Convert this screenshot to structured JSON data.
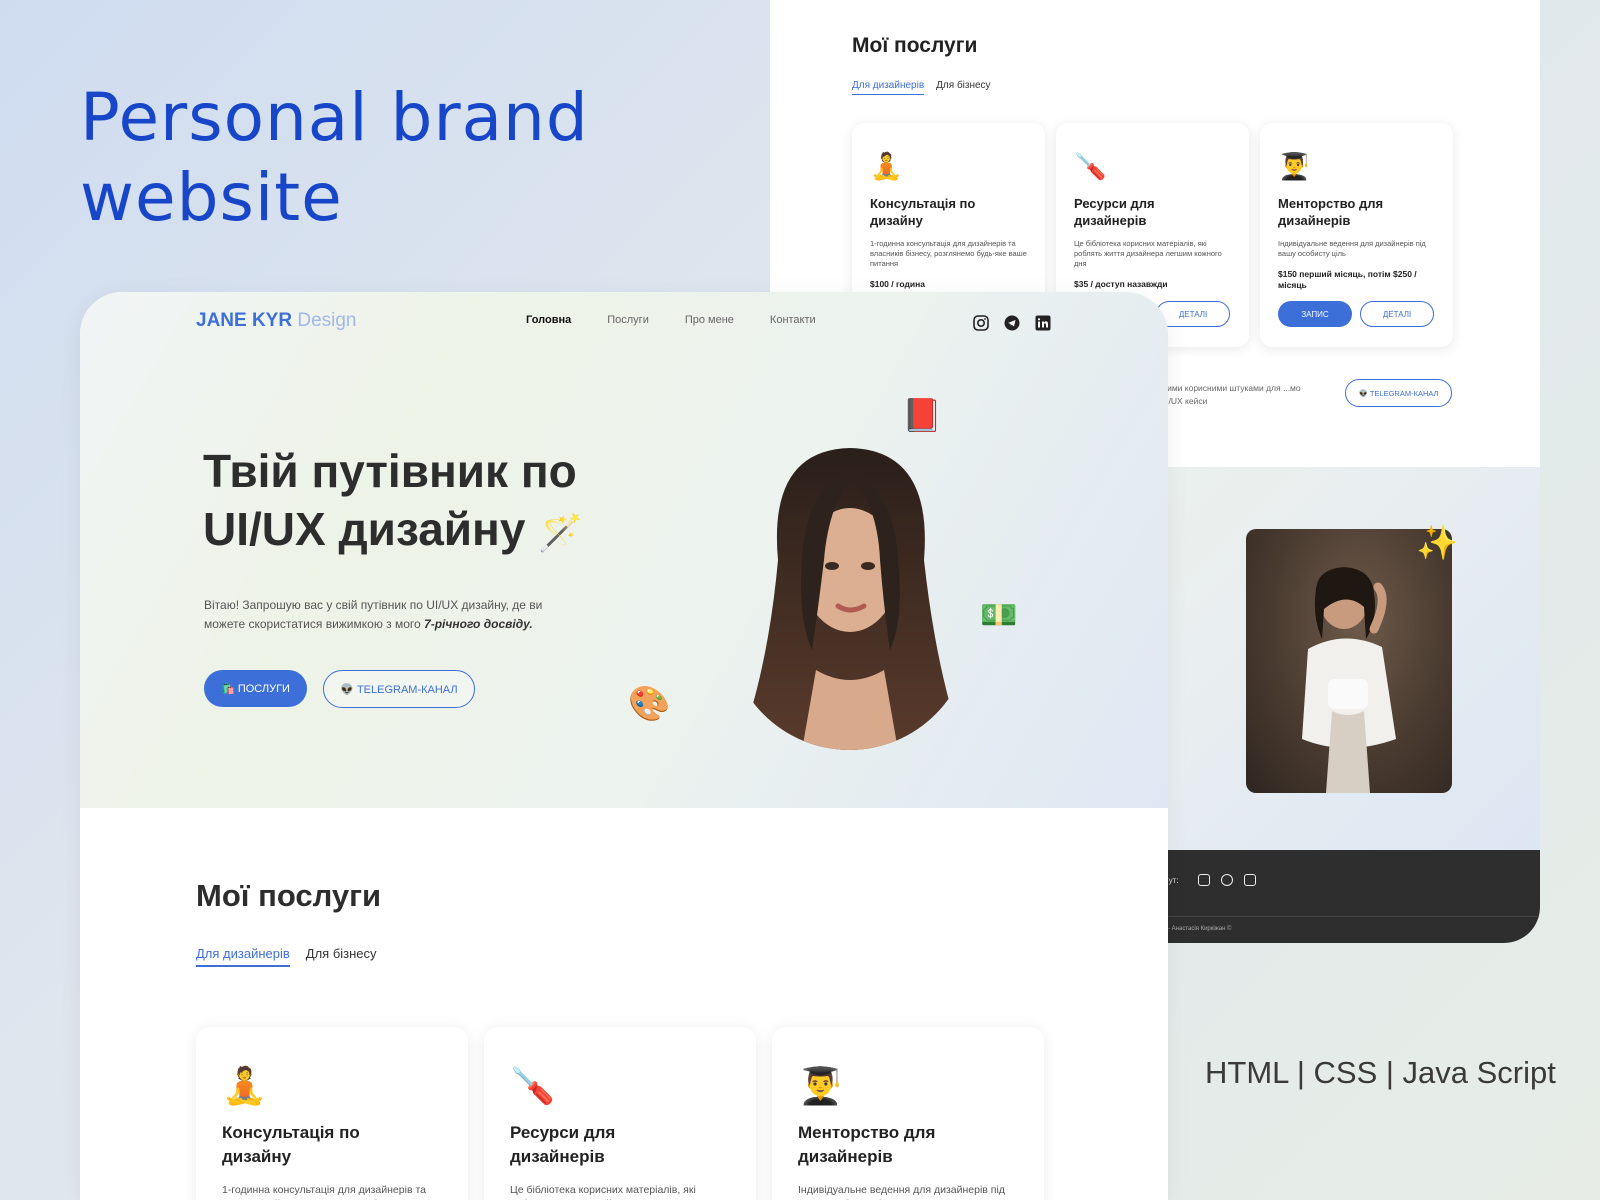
{
  "presentation": {
    "title": "Personal brand website",
    "tech_stack": "HTML | CSS | Java Script"
  },
  "colors": {
    "accent": "#3d6fd8",
    "title_blue": "#1746c9",
    "footer_dark": "#2e2e2e"
  },
  "header": {
    "logo_bold": "JANE KYR",
    "logo_thin": "Design",
    "nav": [
      "Головна",
      "Послуги",
      "Про мене",
      "Контакти"
    ],
    "active_nav": "Головна",
    "social_icons": [
      "instagram-icon",
      "telegram-icon",
      "linkedin-icon"
    ]
  },
  "hero": {
    "title": "Твій путівник по UI/UX дизайну",
    "title_emoji": "🪄",
    "text_before": "Вітаю! Запрошую вас у свій путівник по UI/UX дизайну, де ви можете скористатися вижимкою з мого ",
    "text_emphasis": "7-річного досвіду.",
    "services_button": "🛍️ ПОСЛУГИ",
    "telegram_button": "👽 TELEGRAM-КАНАЛ",
    "decor_emojis": [
      "📕",
      "💵",
      "🎨"
    ]
  },
  "services": {
    "title": "Мої послуги",
    "tabs": [
      "Для дизайнерів",
      "Для бізнесу"
    ],
    "cards": [
      {
        "icon": "🧘",
        "title": "Консультація по дизайну",
        "description": "1-годинна консультація для дизайнерів та власників бізнесу, розглянемо будь-яке ваше питання",
        "price": "$100 / година"
      },
      {
        "icon": "🪛",
        "title": "Ресурси для дизайнерів",
        "description": "Це бібліотека корисних матеріалів, які роблять життя дизайнера легшим кожного дня",
        "price": "$35 / доступ назавжди"
      },
      {
        "icon": "👨‍🎓",
        "title": "Менторство для дизайнерів",
        "description": "Індивідуальне ведення для дизайнерів під вашу особисту ціль",
        "price": "$150 перший місяць, потім $250 / місяць"
      }
    ],
    "book_button": "ЗАПИС",
    "details_button": "ДЕТАЛІ",
    "note": "...ими корисними штуками для ...мо UI/UX кейси",
    "telegram_button": "👽 TELEGRAM-КАНАЛ"
  },
  "about": {
    "sparkle": "✨"
  },
  "footer": {
    "label": "...ут:",
    "copyright": "...а - Анастасія Киркіжан ©"
  }
}
